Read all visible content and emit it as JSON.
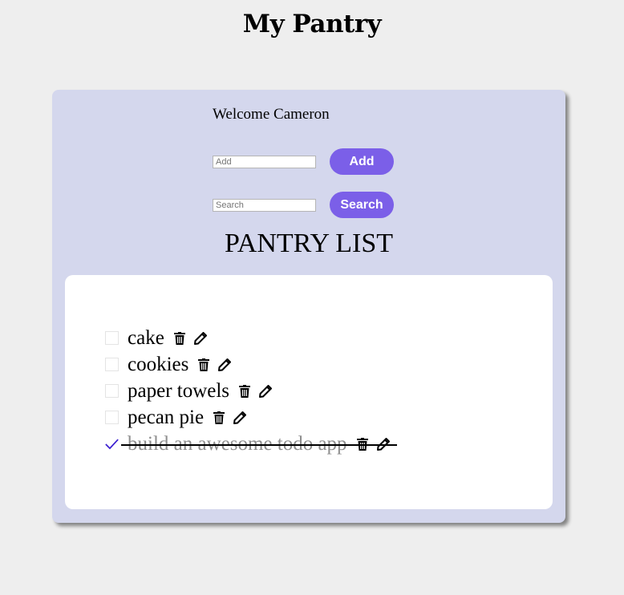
{
  "app": {
    "title": "My Pantry"
  },
  "welcome": "Welcome Cameron",
  "add": {
    "placeholder": "Add",
    "button_label": "Add"
  },
  "search": {
    "placeholder": "Search",
    "button_label": "Search"
  },
  "list": {
    "heading": "PANTRY LIST",
    "items": [
      {
        "label": "cake",
        "done": false
      },
      {
        "label": "cookies",
        "done": false
      },
      {
        "label": "paper towels",
        "done": false
      },
      {
        "label": "pecan pie",
        "done": false
      },
      {
        "label": "build an awesome todo app",
        "done": true
      }
    ]
  },
  "icons": {
    "delete": "trash-icon",
    "edit": "pencil-icon",
    "done": "checkmark-icon"
  },
  "colors": {
    "accent": "#7b5fe8",
    "card": "#d4d7ed",
    "background": "#eeeeee",
    "check": "#3b1fd1"
  }
}
